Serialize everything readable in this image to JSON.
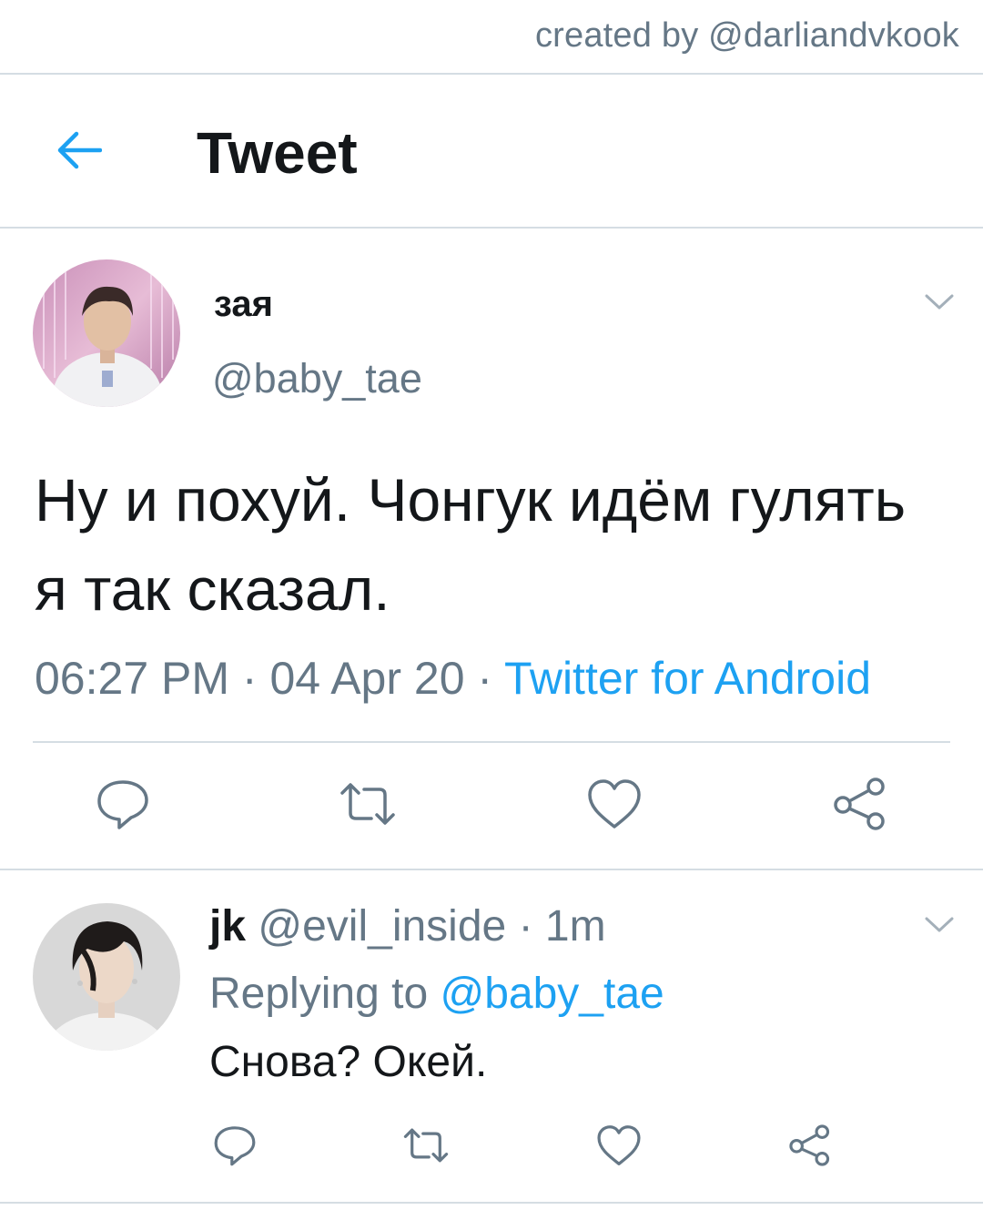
{
  "watermark": "created by @darliandvkook",
  "header": {
    "title": "Tweet",
    "back_icon": "arrow-left-icon"
  },
  "tweet": {
    "display_name": "зая",
    "handle": "@baby_tae",
    "text": "Ну и похуй. Чонгук идём гулять я так сказал.",
    "time": "06:27 PM",
    "sep1": " · ",
    "date": "04 Apr 20",
    "sep2": " · ",
    "source": "Twitter for Android",
    "actions": [
      "reply-icon",
      "retweet-icon",
      "like-icon",
      "share-icon"
    ]
  },
  "reply": {
    "display_name": "jk",
    "handle": "@evil_inside",
    "sep": " · ",
    "time_ago": "1m",
    "replying_prefix": "Replying to ",
    "replying_to": "@baby_tae",
    "text": "Снова? Окей.",
    "actions": [
      "reply-icon",
      "retweet-icon",
      "like-icon",
      "share-icon"
    ]
  },
  "colors": {
    "accent": "#1da1f2",
    "secondary_text": "#657786",
    "primary_text": "#14171a",
    "divider": "#d5dde3",
    "icon": "#657786"
  }
}
